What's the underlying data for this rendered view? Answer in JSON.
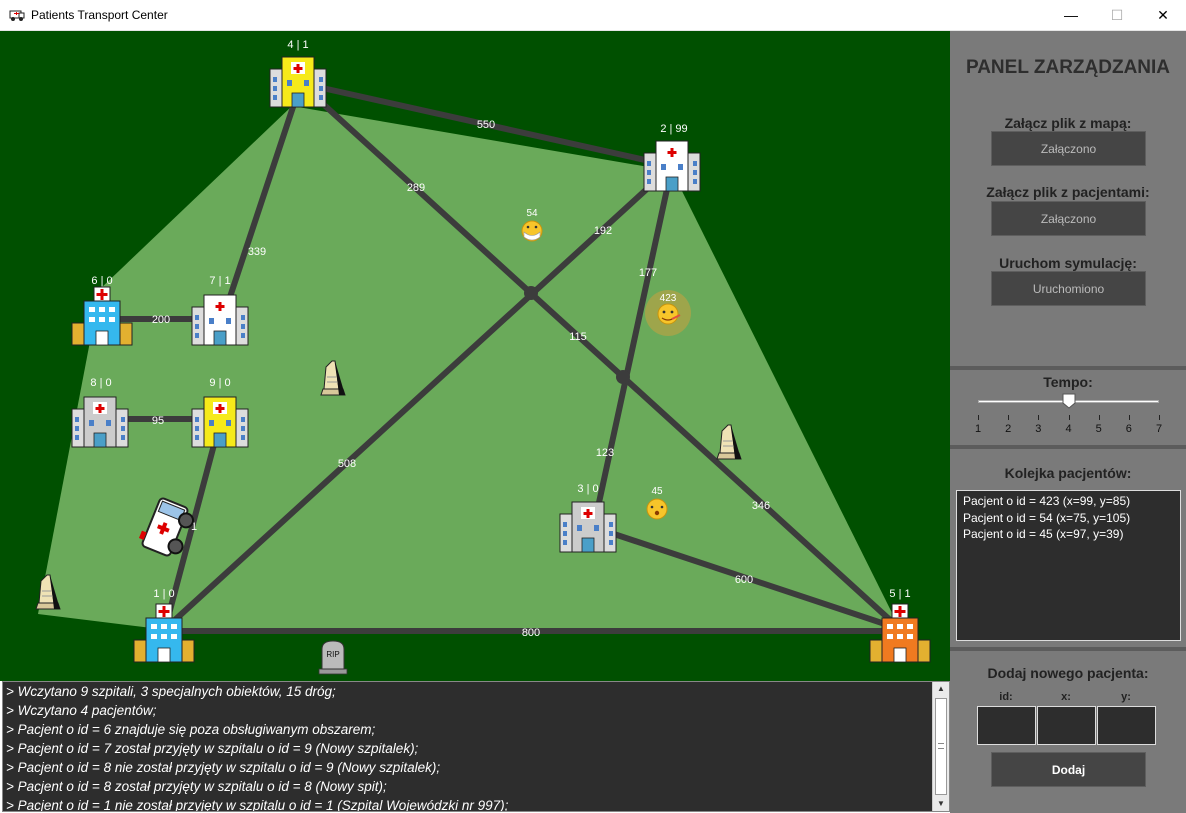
{
  "window": {
    "title": "Patients Transport Center",
    "minimize_icon": "minimize-icon",
    "maximize_icon": "maximize-icon",
    "close_icon": "close-icon",
    "minimize_glyph": "—",
    "maximize_glyph": "☐",
    "close_glyph": "✕"
  },
  "map": {
    "colors": {
      "background": "#005000",
      "area": "#6aaa5a",
      "road": "#3c3c3c"
    },
    "hospital_labels": {
      "h1": "1 | 0",
      "h2": "2 | 99",
      "h3": "3 | 0",
      "h4": "4 | 1",
      "h5": "5 | 1",
      "h6": "6 | 0",
      "h7": "7 | 1",
      "h8": "8 | 0",
      "h9": "9 | 0"
    },
    "road_labels": {
      "r550": "550",
      "r289": "289",
      "r192": "192",
      "r339": "339",
      "r200": "200",
      "r177": "177",
      "r115": "115",
      "r95": "95",
      "r123": "123",
      "r508": "508",
      "r346": "346",
      "r600": "600",
      "r800": "800",
      "r1": "1"
    },
    "patients": {
      "p54": "54",
      "p423": "423",
      "p45": "45"
    },
    "tombstone_text": "RIP"
  },
  "console": {
    "lines": [
      "> Wczytano 9 szpitali, 3 specjalnych obiektów, 15 dróg;",
      "> Wczytano 4 pacjentów;",
      "> Pacjent o id = 6 znajduje się poza obsługiwanym obszarem;",
      "> Pacjent o id = 7 został przyjęty w szpitalu o id = 9 (Nowy szpitalek);",
      "> Pacjent o id = 8 nie został przyjęty w szpitalu o id = 9 (Nowy szpitalek);",
      "> Pacjent o id = 8 został przyjęty w szpitalu o id = 8 (Nowy spit);",
      "> Pacjent o id = 1 nie został przyjęty w szpitalu o id = 1 (Szpital Wojewódzki nr 997);"
    ]
  },
  "panel": {
    "title": "PANEL ZARZĄDZANIA",
    "map_file_label": "Załącz plik z mapą:",
    "map_file_button": "Załączono",
    "patients_file_label": "Załącz plik z pacjentami:",
    "patients_file_button": "Załączono",
    "simulation_label": "Uruchom symulację:",
    "simulation_button": "Uruchomiono",
    "tempo_label": "Tempo:",
    "tempo_ticks": [
      "1",
      "2",
      "3",
      "4",
      "5",
      "6",
      "7"
    ],
    "tempo_value": 4,
    "queue_label": "Kolejka pacjentów:",
    "queue": [
      "Pacjent o id = 423 (x=99, y=85)",
      "Pacjent o id = 54 (x=75, y=105)",
      "Pacjent o id = 45 (x=97, y=39)"
    ],
    "add_label": "Dodaj nowego pacjenta:",
    "id_label": "id:",
    "x_label": "x:",
    "y_label": "y:",
    "add_button": "Dodaj"
  }
}
